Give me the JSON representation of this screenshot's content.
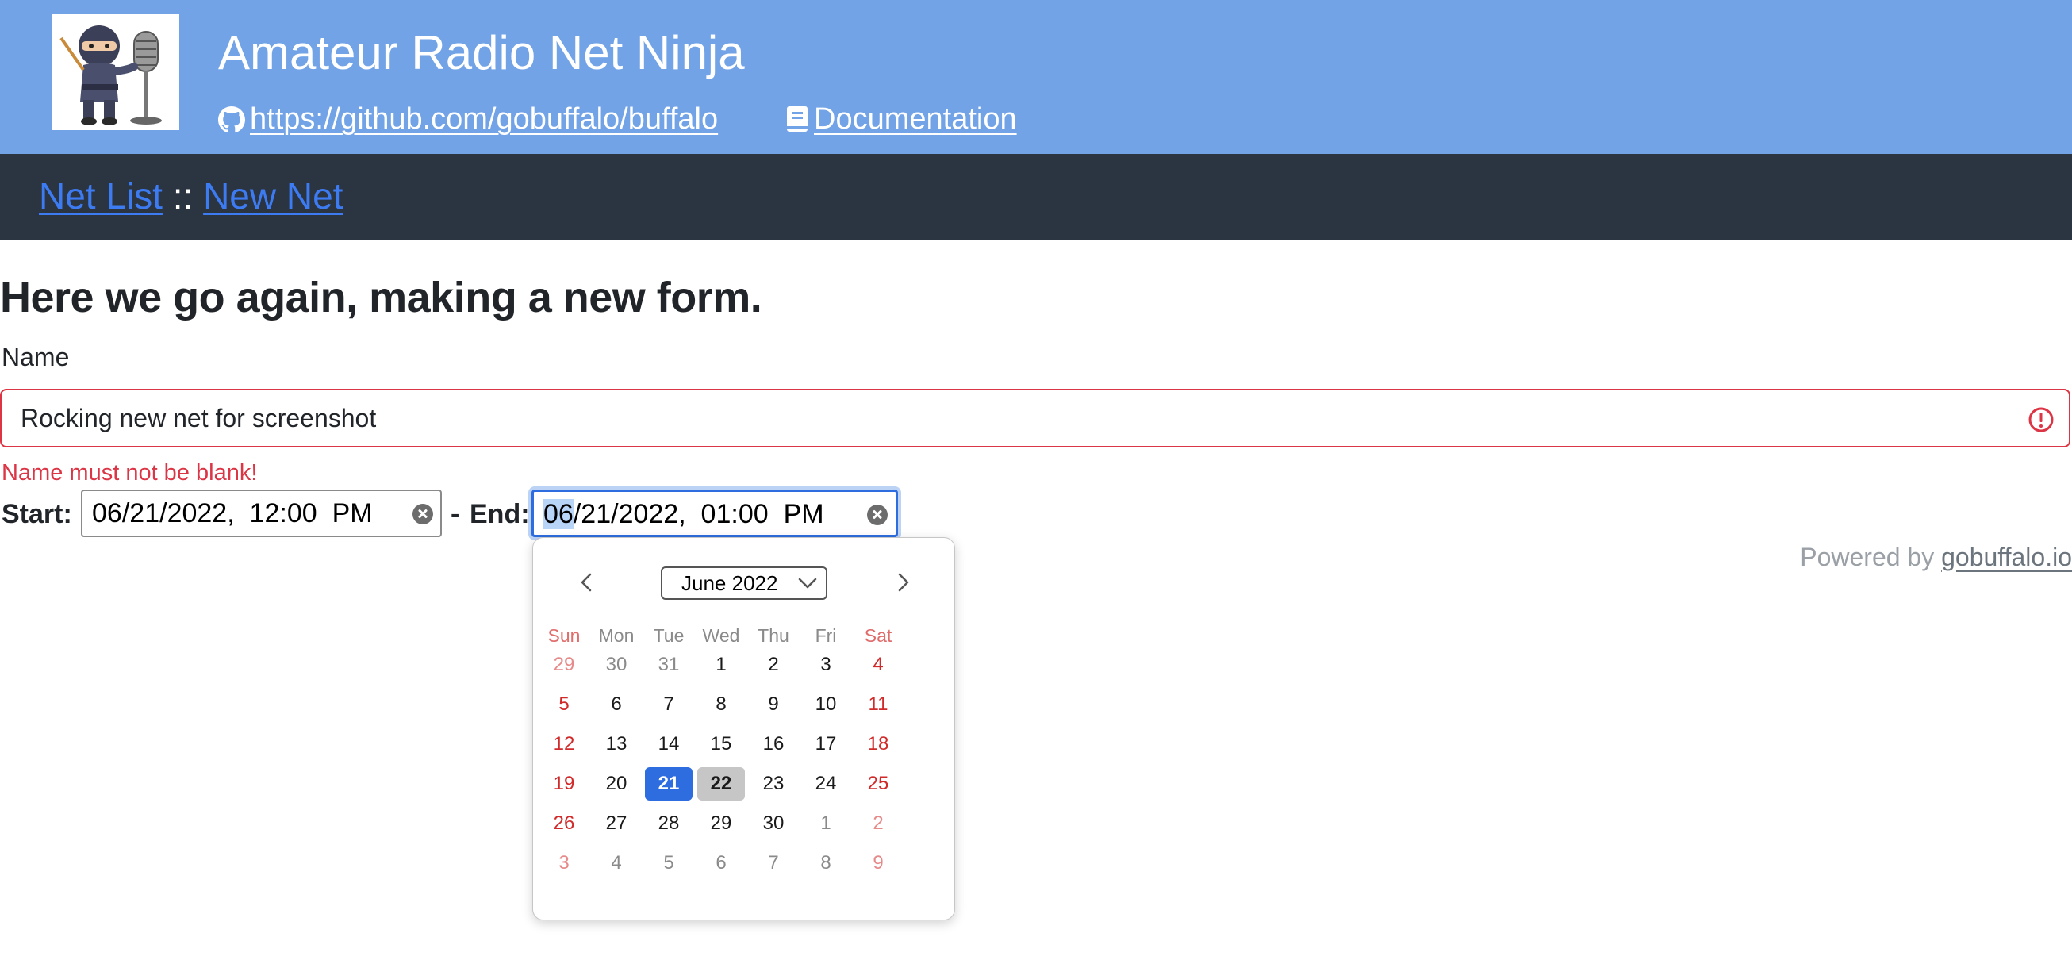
{
  "header": {
    "app_title": "Amateur Radio Net Ninja",
    "github_link": "https://github.com/gobuffalo/buffalo",
    "docs_link": "Documentation"
  },
  "nav": {
    "net_list": "Net List",
    "separator": "::",
    "new_net": "New Net"
  },
  "form": {
    "heading": "Here we go again, making a new form.",
    "name_label": "Name",
    "name_value": "Rocking new net for screenshot",
    "name_error": "Name must not be blank!",
    "start_label": "Start:",
    "range_sep": "-",
    "end_label": "End:",
    "start": {
      "month": "06",
      "day": "21",
      "year": "2022",
      "hour": "12",
      "minute": "00",
      "ampm": "PM"
    },
    "end": {
      "month": "06",
      "day": "21",
      "year": "2022",
      "hour": "01",
      "minute": "00",
      "ampm": "PM"
    }
  },
  "footer": {
    "powered_by": "Powered by",
    "powered_link": "gobuffalo.io"
  },
  "calendar": {
    "month_label": "June 2022",
    "weekdays": [
      "Sun",
      "Mon",
      "Tue",
      "Wed",
      "Thu",
      "Fri",
      "Sat"
    ],
    "weeks": [
      [
        "29",
        "30",
        "31",
        "1",
        "2",
        "3",
        "4"
      ],
      [
        "5",
        "6",
        "7",
        "8",
        "9",
        "10",
        "11"
      ],
      [
        "12",
        "13",
        "14",
        "15",
        "16",
        "17",
        "18"
      ],
      [
        "19",
        "20",
        "21",
        "22",
        "23",
        "24",
        "25"
      ],
      [
        "26",
        "27",
        "28",
        "29",
        "30",
        "1",
        "2"
      ],
      [
        "3",
        "4",
        "5",
        "6",
        "7",
        "8",
        "9"
      ]
    ],
    "selected_day": "21",
    "today_day": "22"
  },
  "colors": {
    "header_bg": "#71a3e6",
    "nav_bg": "#2b3441",
    "link": "#3d7bf2",
    "error": "#dc3545",
    "selected": "#2d6ddf",
    "weekend": "#d12a2a"
  }
}
